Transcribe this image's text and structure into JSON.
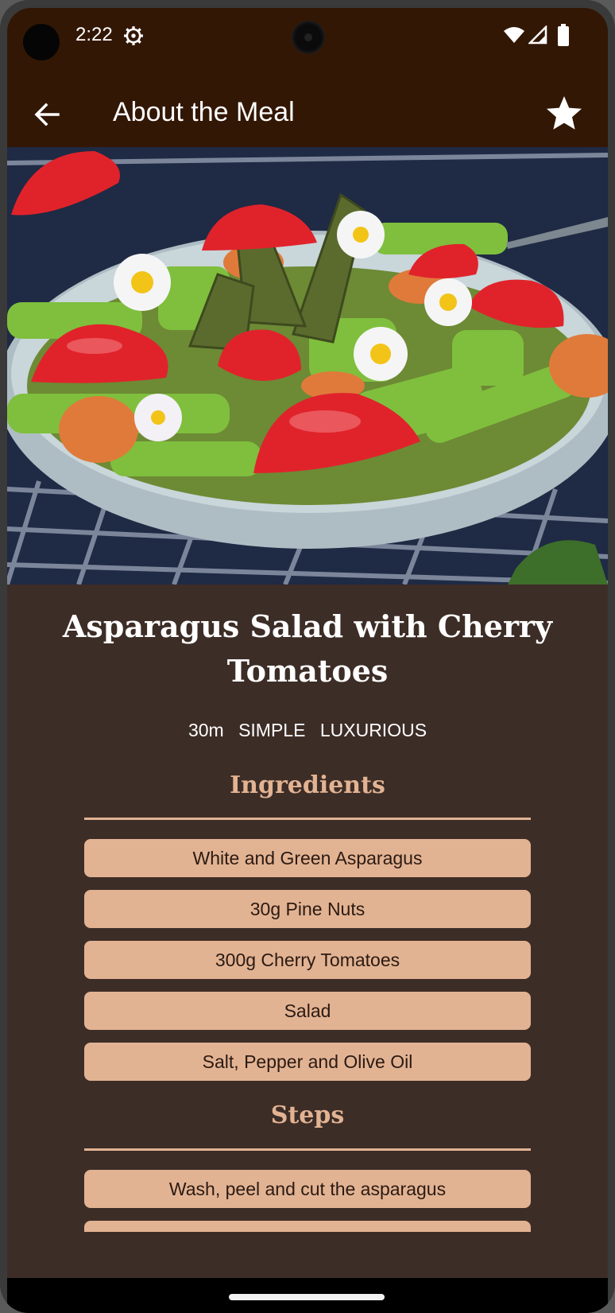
{
  "status_bar": {
    "time": "2:22",
    "icons": [
      "settings-icon",
      "wifi-icon",
      "signal-icon",
      "battery-icon"
    ]
  },
  "app_bar": {
    "title": "About the Meal",
    "back_icon": "arrow-left-icon",
    "favorite_icon": "star-icon"
  },
  "hero_image": {
    "description": "Asparagus salad with strawberries and daisies"
  },
  "meal": {
    "title": "Asparagus Salad with Cherry Tomatoes",
    "duration": "30m",
    "complexity": "SIMPLE",
    "affordability": "LUXURIOUS"
  },
  "ingredients": {
    "heading": "Ingredients",
    "items": [
      "White and Green Asparagus",
      "30g Pine Nuts",
      "300g Cherry Tomatoes",
      "Salad",
      "Salt, Pepper and Olive Oil"
    ]
  },
  "steps": {
    "heading": "Steps",
    "items": [
      "Wash, peel and cut the asparagus"
    ]
  },
  "colors": {
    "app_bar": "#331705",
    "background": "#3d2d27",
    "accent": "#e2b393",
    "text": "#ffffff"
  }
}
